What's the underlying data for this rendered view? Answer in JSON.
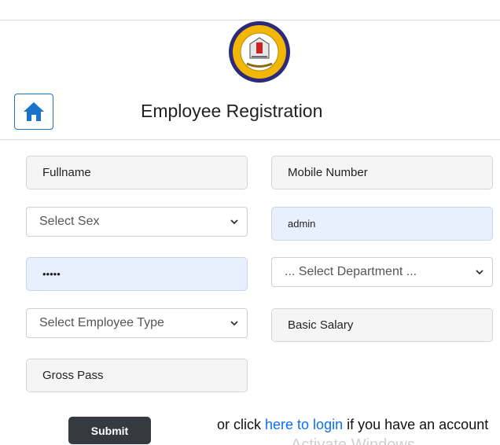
{
  "header": {
    "title": "Employee Registration",
    "logo_icon": "school-crest-icon",
    "home_icon": "home-icon"
  },
  "form": {
    "fullname_placeholder": "Fullname",
    "mobile_placeholder": "Mobile Number",
    "sex_select_value": "Select Sex",
    "username_value": "admin",
    "password_value": "•••••",
    "department_select_value": "... Select Department ...",
    "employee_type_select_value": "Select Employee Type",
    "basic_salary_placeholder": "Basic Salary",
    "gross_pass_placeholder": "Gross Pass",
    "submit_label": "Submit"
  },
  "footer": {
    "prefix": "or click ",
    "link_text": "here to login",
    "suffix": " if you have an account",
    "watermark": "Activate Windows"
  },
  "colors": {
    "accent": "#1a73c9",
    "submit_bg": "#343a40",
    "link": "#0d6efd",
    "autofill_bg": "#e8f0fe"
  }
}
